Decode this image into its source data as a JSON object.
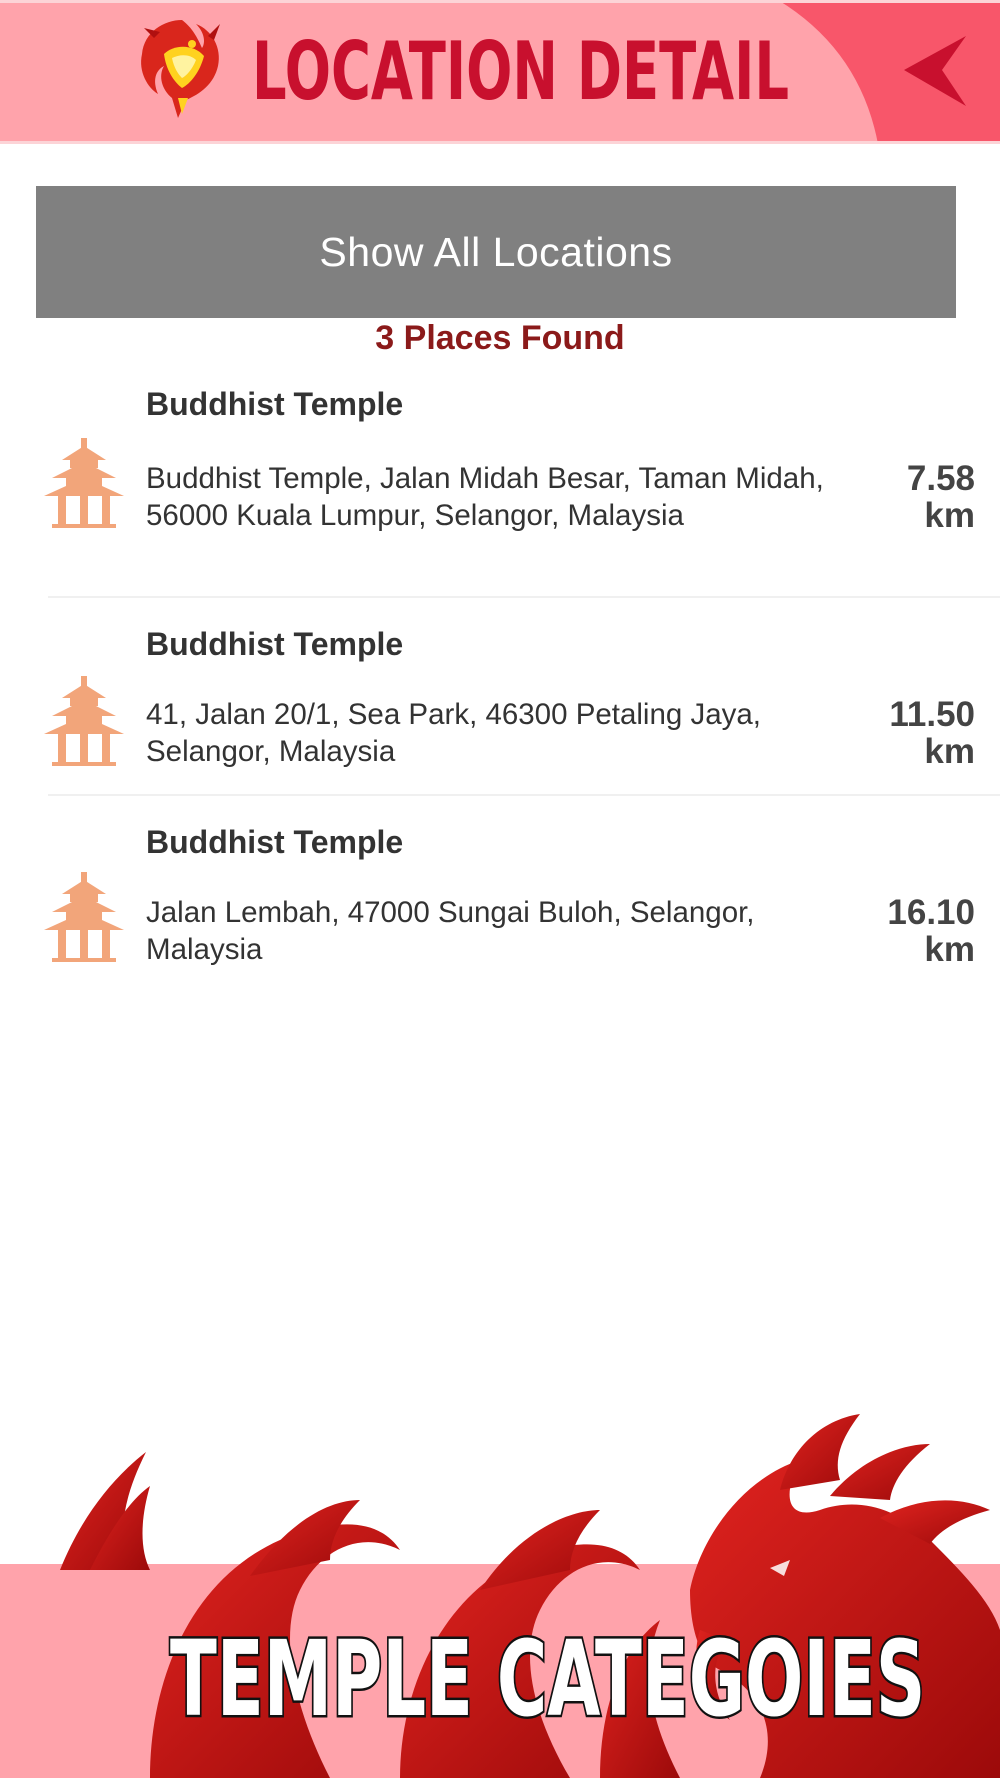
{
  "header": {
    "title": "LOCATION DETAIL",
    "logo_icon": "dragon-logo-icon",
    "back_icon": "back-arrow-icon",
    "background_color": "#ffa3ab",
    "accent_color": "#c8102e"
  },
  "actions": {
    "show_all_label": "Show All Locations"
  },
  "results": {
    "count_label": "3 Places Found"
  },
  "locations": [
    {
      "icon": "pagoda-icon",
      "name": "Buddhist Temple",
      "address": "Buddhist Temple, Jalan Midah Besar, Taman Midah, 56000 Kuala Lumpur, Selangor, Malaysia",
      "distance_value": "7.58",
      "distance_unit": "km"
    },
    {
      "icon": "pagoda-icon",
      "name": "Buddhist Temple",
      "address": "41, Jalan 20/1, Sea Park, 46300 Petaling Jaya, Selangor, Malaysia",
      "distance_value": "11.50",
      "distance_unit": "km"
    },
    {
      "icon": "pagoda-icon",
      "name": "Buddhist Temple",
      "address": "Jalan Lembah, 47000 Sungai Buloh, Selangor, Malaysia",
      "distance_value": "16.10",
      "distance_unit": "km"
    }
  ],
  "footer": {
    "caption": "TEMPLE CATEGOIES",
    "dragon_color": "#cc0000"
  }
}
